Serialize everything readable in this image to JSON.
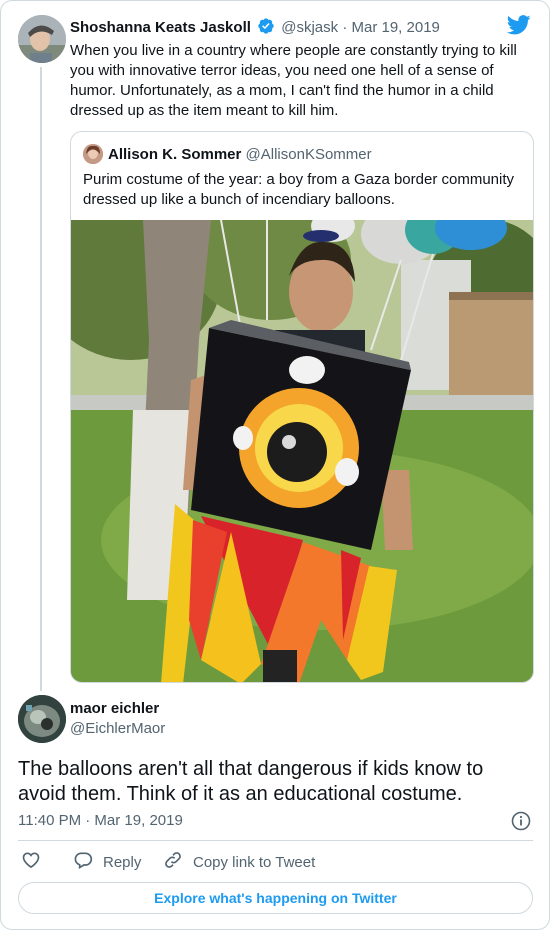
{
  "parent_tweet": {
    "author_name": "Shoshanna Keats Jaskoll",
    "author_handle": "@skjask",
    "separator": "·",
    "date": "Mar 19, 2019",
    "text": "When you live in a country where people are constantly trying to kill you with innovative terror ideas, you need one hell of a sense of humor. Unfortunately, as a mom, I can't find the humor in a child dressed up as the item meant to kill him."
  },
  "quoted_tweet": {
    "author_name": "Allison K. Sommer",
    "author_handle": "@AllisonKSommer",
    "text": "Purim costume of the year: a boy from a Gaza border community dressed up like a bunch of incendiary balloons."
  },
  "reply_tweet": {
    "author_name": "maor eichler",
    "author_handle": "@EichlerMaor",
    "text": "The balloons aren't all that dangerous if kids know to avoid them. Think of it as an educational costume.",
    "timestamp": "11:40 PM · Mar 19, 2019"
  },
  "actions": {
    "reply_label": "Reply",
    "copy_link_label": "Copy link to Tweet"
  },
  "explore_label": "Explore what's happening on Twitter",
  "colors": {
    "accent": "#1d9bf0",
    "text": "#0f1419",
    "muted": "#536471",
    "border": "#cfd9de"
  },
  "icons": [
    "twitter-bird-icon",
    "verified-badge-icon",
    "info-icon",
    "heart-icon",
    "reply-icon",
    "link-icon"
  ]
}
